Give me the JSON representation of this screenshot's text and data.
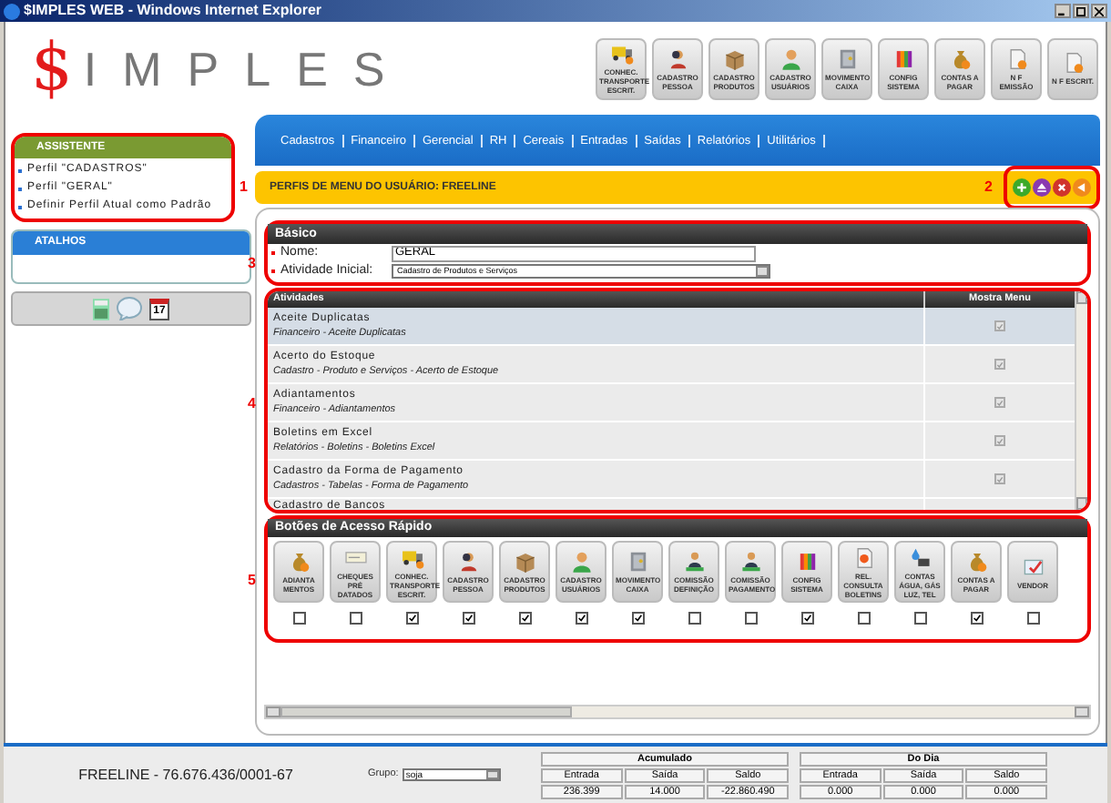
{
  "window": {
    "title": "$IMPLES WEB - Windows Internet Explorer"
  },
  "logo": {
    "symbol": "$",
    "text": "IMPLES"
  },
  "top_buttons": [
    {
      "label": "CONHEC. TRANSPORTE ESCRIT.",
      "kind": "truck"
    },
    {
      "label": "CADASTRO PESSOA",
      "kind": "person"
    },
    {
      "label": "CADASTRO PRODUTOS",
      "kind": "box"
    },
    {
      "label": "CADASTRO USUÁRIOS",
      "kind": "user"
    },
    {
      "label": "MOVIMENTO CAIXA",
      "kind": "safe"
    },
    {
      "label": "CONFIG SISTEMA",
      "kind": "palette"
    },
    {
      "label": "CONTAS A PAGAR",
      "kind": "bag"
    },
    {
      "label": "N F EMISSÃO",
      "kind": "doc"
    },
    {
      "label": "N F ESCRIT.",
      "kind": "doc"
    }
  ],
  "menu": [
    "Cadastros",
    "Financeiro",
    "Gerencial",
    "RH",
    "Cereais",
    "Entradas",
    "Saídas",
    "Relatórios",
    "Utilitários"
  ],
  "sidebar": {
    "assistant": {
      "title": "ASSISTENTE",
      "items": [
        "Perfil \"CADASTROS\"",
        "Perfil \"GERAL\"",
        "Definir Perfil Atual como Padrão"
      ]
    },
    "shortcuts": {
      "title": "ATALHOS"
    },
    "calendar_day": "17"
  },
  "annotations": [
    "1",
    "2",
    "3",
    "4",
    "5"
  ],
  "page_title": "PERFIS DE MENU DO USUÁRIO: FREELINE",
  "action_buttons": [
    {
      "kind": "add"
    },
    {
      "kind": "up"
    },
    {
      "kind": "delete"
    },
    {
      "kind": "back"
    }
  ],
  "basic": {
    "title": "Básico",
    "fields": [
      {
        "label": "Nome:",
        "value": "GERAL",
        "kind": "text"
      },
      {
        "label": "Atividade Inicial:",
        "value": "Cadastro de Produtos e Serviços",
        "kind": "select"
      }
    ]
  },
  "activities": {
    "columns": [
      "Atividades",
      "Mostra Menu"
    ],
    "rows": [
      {
        "title": "Aceite Duplicatas",
        "path": "Financeiro - Aceite Duplicatas",
        "selected": true,
        "checked": true,
        "disabled": true
      },
      {
        "title": "Acerto do Estoque",
        "path": "Cadastro - Produto e Serviços  - Acerto de Estoque",
        "selected": false,
        "checked": true,
        "disabled": true
      },
      {
        "title": "Adiantamentos",
        "path": "Financeiro - Adiantamentos",
        "selected": false,
        "checked": true,
        "disabled": true
      },
      {
        "title": "Boletins em Excel",
        "path": "Relatórios  - Boletins - Boletins Excel",
        "selected": false,
        "checked": true,
        "disabled": true
      },
      {
        "title": "Cadastro da Forma de Pagamento",
        "path": "Cadastros - Tabelas - Forma de Pagamento",
        "selected": false,
        "checked": true,
        "disabled": true
      },
      {
        "title": "Cadastro de Bancos",
        "selected": false
      }
    ]
  },
  "quick_access": {
    "title": "Botões de Acesso Rápido",
    "buttons": [
      {
        "label": "ADIANTA MENTOS",
        "kind": "bag",
        "checked": false
      },
      {
        "label": "CHEQUES PRÉ DATADOS",
        "kind": "cheque",
        "checked": false
      },
      {
        "label": "CONHEC. TRANSPORTE ESCRIT.",
        "kind": "truck",
        "checked": true
      },
      {
        "label": "CADASTRO PESSOA",
        "kind": "person",
        "checked": true
      },
      {
        "label": "CADASTRO PRODUTOS",
        "kind": "box",
        "checked": true
      },
      {
        "label": "CADASTRO USUÁRIOS",
        "kind": "user",
        "checked": true
      },
      {
        "label": "MOVIMENTO CAIXA",
        "kind": "safe",
        "checked": true
      },
      {
        "label": "COMISSÃO DEFINIÇÃO",
        "kind": "people",
        "checked": false
      },
      {
        "label": "COMISSÃO PAGAMENTO",
        "kind": "people",
        "checked": false
      },
      {
        "label": "CONFIG SISTEMA",
        "kind": "palette",
        "checked": true
      },
      {
        "label": "REL. CONSULTA BOLETINS",
        "kind": "chart",
        "checked": false
      },
      {
        "label": "CONTAS ÁGUA, GÁS LUZ, TEL",
        "kind": "utility",
        "checked": false
      },
      {
        "label": "CONTAS A PAGAR",
        "kind": "bag",
        "checked": true
      },
      {
        "label": "VENDOR",
        "kind": "vendor",
        "checked": false
      }
    ]
  },
  "status_bar": {
    "company": "FREELINE - 76.676.436/0001-67",
    "group_label": "Grupo:",
    "group_value": "soja",
    "tables": [
      {
        "title": "Acumulado",
        "columns": [
          "Entrada",
          "Saída",
          "Saldo"
        ],
        "values": [
          "236.399",
          "14.000",
          "-22.860.490"
        ]
      },
      {
        "title": "Do Dia",
        "columns": [
          "Entrada",
          "Saída",
          "Saldo"
        ],
        "values": [
          "0.000",
          "0.000",
          "0.000"
        ]
      }
    ]
  }
}
